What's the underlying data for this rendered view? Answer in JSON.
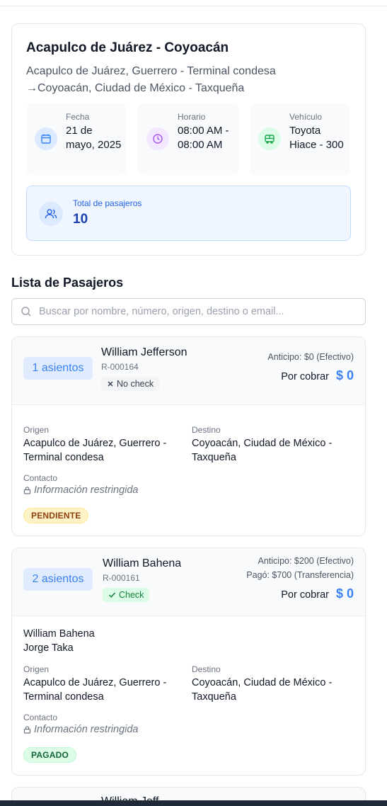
{
  "trip": {
    "title": "Acapulco de Juárez - Coyoacán",
    "route_line1": "Acapulco de Juárez, Guerrero - Terminal condesa",
    "route_line2": "→Coyoacán, Ciudad de México - Taxqueña",
    "date": {
      "label": "Fecha",
      "value": "21 de mayo, 2025",
      "icon": "calendar-icon"
    },
    "schedule": {
      "label": "Horario",
      "value": "08:00 AM - 08:00 AM",
      "icon": "clock-icon"
    },
    "vehicle": {
      "label": "Vehículo",
      "value": "Toyota Hiace - 300",
      "icon": "bus-icon"
    },
    "total": {
      "label": "Total de pasajeros",
      "value": "10",
      "icon": "users-icon"
    }
  },
  "passengers_section": {
    "title": "Lista de Pasajeros",
    "search_placeholder": "Buscar por nombre, número, origen, destino o email..."
  },
  "passengers": [
    {
      "seats": "1 asientos",
      "name": "William Jefferson",
      "code": "R-000164",
      "check": "No check",
      "payments": [
        "Anticipo: $0 (Efectivo)"
      ],
      "cobrar_label": "Por cobrar",
      "cobrar_amount": "$ 0",
      "travelers": [],
      "origin_label": "Origen",
      "origin": "Acapulco de Juárez, Guerrero - Terminal condesa",
      "dest_label": "Destino",
      "dest": "Coyoacán, Ciudad de México - Taxqueña",
      "contact_label": "Contacto",
      "contact": "Información restringida",
      "status": "PENDIENTE",
      "status_color": "#fef3c7"
    },
    {
      "seats": "2 asientos",
      "name": "William Bahena",
      "code": "R-000161",
      "check": "Check",
      "payments": [
        "Anticipo: $200 (Efectivo)",
        "Pagó: $700 (Transferencia)"
      ],
      "cobrar_label": "Por cobrar",
      "cobrar_amount": "$ 0",
      "travelers": [
        "William Bahena",
        "Jorge Taka"
      ],
      "origin_label": "Origen",
      "origin": "Acapulco de Juárez, Guerrero - Terminal condesa",
      "dest_label": "Destino",
      "dest": "Coyoacán, Ciudad de México - Taxqueña",
      "contact_label": "Contacto",
      "contact": "Información restringida",
      "status": "PAGADO",
      "status_color": "#dcfce7"
    },
    {
      "name": "William Jeff"
    }
  ],
  "colors": {
    "accent": "#3b82f6",
    "total_bg": "#eff6ff",
    "pending": "#fef3c7",
    "paid": "#dcfce7"
  }
}
